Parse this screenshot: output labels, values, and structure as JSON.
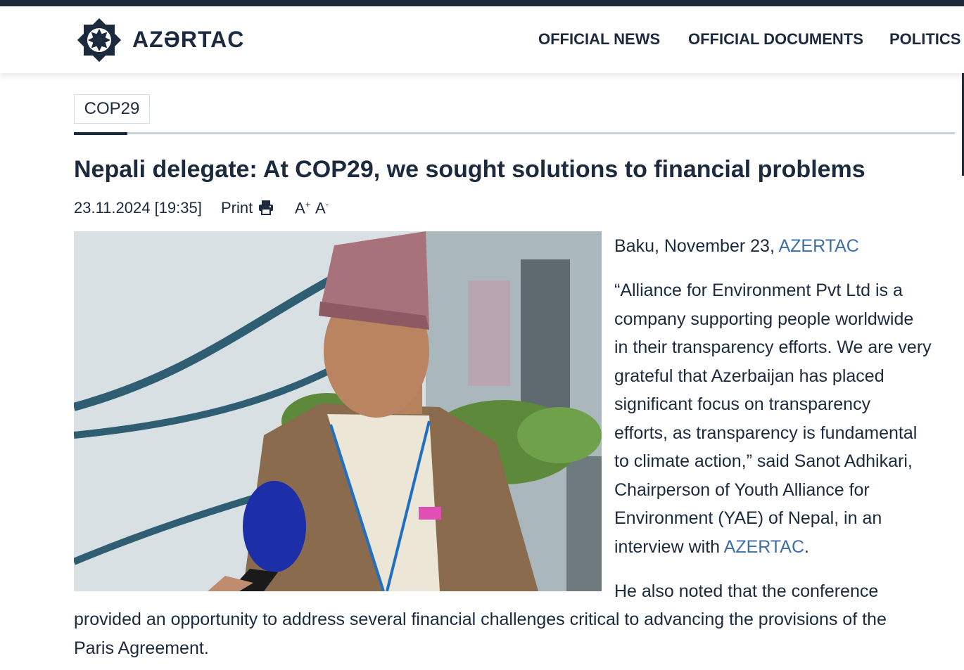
{
  "header": {
    "logo_text": "AZƏRTAC",
    "nav": [
      {
        "label": "OFFICIAL NEWS"
      },
      {
        "label": "OFFICIAL DOCUMENTS"
      },
      {
        "label": "POLITICS"
      }
    ]
  },
  "article": {
    "category": "COP29",
    "title": "Nepali delegate: At COP29, we sought solutions to financial problems",
    "datetime": "23.11.2024 [19:35]",
    "print_label": "Print",
    "font_increase": "A",
    "font_decrease": "A",
    "dateline_prefix": "Baku, November 23,",
    "source_link": "AZERTAC",
    "para1_lines": [
      "“Alliance for Environment Pvt Ltd is a",
      "company supporting people worldwide",
      "in their transparency efforts. We are very",
      "grateful that Azerbaijan has placed",
      "significant focus on transparency",
      "efforts, as transparency is fundamental",
      "to climate action,” said Sanot Adhikari,",
      "Chairperson of Youth Alliance for",
      "Environment (YAE) of Nepal, in an"
    ],
    "para1_last_prefix": "interview with",
    "para1_last_link": "AZERTAC",
    "para1_last_suffix": ".",
    "para2_line1": "He also noted that the conference",
    "para2_line2": "provided an opportunity to address several financial challenges critical to advancing the provisions of the",
    "para2_line3": "Paris Agreement."
  },
  "icons": {
    "logo": "azertac-snowflake-logo",
    "print": "printer-icon",
    "nav_more": "chevron-right-icon"
  },
  "colors": {
    "brand_dark": "#1c2a3e",
    "link": "#3d6ea8"
  }
}
